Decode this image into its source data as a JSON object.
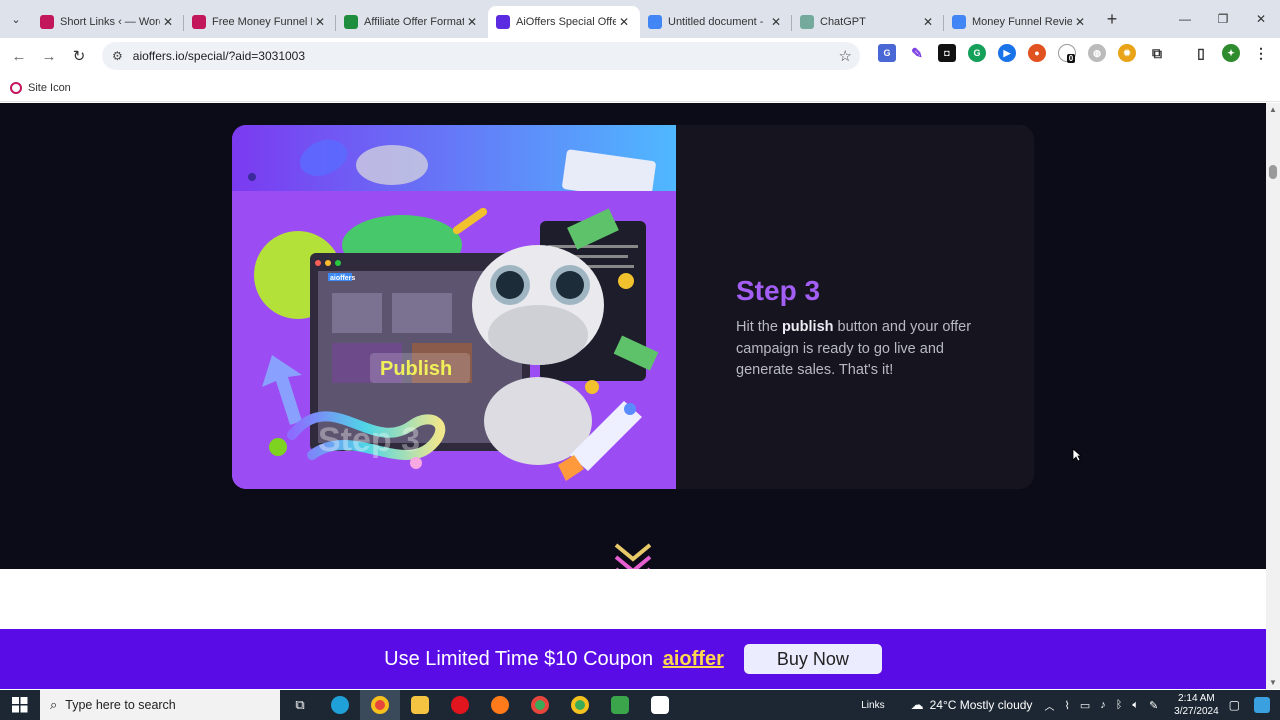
{
  "browser": {
    "tabs": [
      {
        "title": "Short Links ‹ — Word",
        "favicon_color": "#c2185b",
        "active": false
      },
      {
        "title": "Free Money Funnel R",
        "favicon_color": "#c2185b",
        "active": false
      },
      {
        "title": "Affiliate Offer Format",
        "favicon_color": "#1e8e3e",
        "active": false
      },
      {
        "title": "AiOffers Special Offe",
        "favicon_color": "#5a2be0",
        "active": true
      },
      {
        "title": "Untitled document -",
        "favicon_color": "#4285f4",
        "active": false
      },
      {
        "title": "ChatGPT",
        "favicon_color": "#74aa9c",
        "active": false
      },
      {
        "title": "Money Funnel Revie",
        "favicon_color": "#4285f4",
        "active": false
      }
    ],
    "close_glyph": "✕",
    "new_tab_glyph": "+",
    "window_controls": {
      "minimize": "—",
      "restore": "❐",
      "close": "✕"
    },
    "url": "aioffers.io/special/?aid=3031003",
    "extension_badge": "0",
    "bookmark_label": "Site Icon"
  },
  "page": {
    "step_title": "Step 3",
    "step_desc_prefix": "Hit the ",
    "step_desc_bold": "publish",
    "step_desc_suffix": " button and your offer campaign is ready to go live and generate sales. That's it!",
    "image_publish_label": "Publish",
    "image_step_watermark": "Step 3",
    "image_brand": "aioffers",
    "coupon_prefix": "Use Limited Time $10 Coupon",
    "coupon_code": "aioffer",
    "buy_button": "Buy Now",
    "colors": {
      "accent": "#a35ff5",
      "coupon_bar": "#5a0ce6",
      "coupon_code": "#ffd84d",
      "dark_bg": "#0c0b18"
    }
  },
  "taskbar": {
    "search_placeholder": "Type here to search",
    "links_label": "Links",
    "weather": "24°C  Mostly cloudy",
    "time": "2:14 AM",
    "date": "3/27/2024"
  }
}
